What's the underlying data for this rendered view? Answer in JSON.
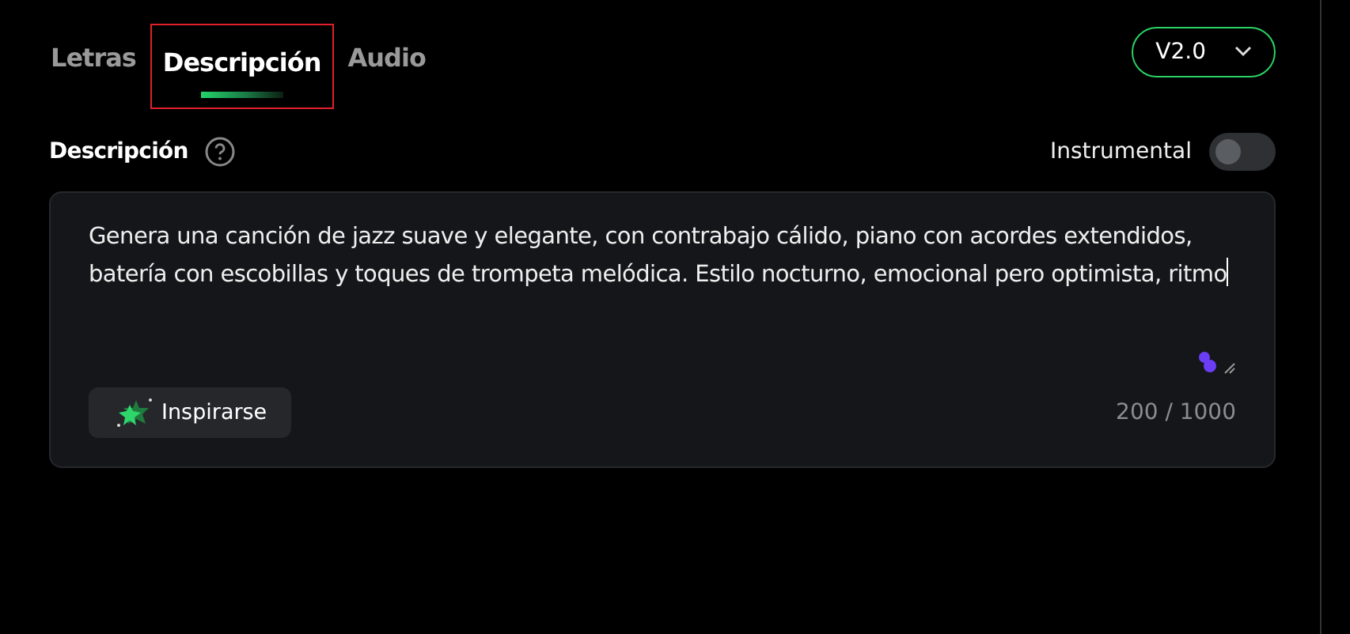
{
  "tabs": [
    {
      "label": "Letras",
      "selected": false
    },
    {
      "label": "Descripción",
      "selected": true
    },
    {
      "label": "Audio",
      "selected": false
    }
  ],
  "version_select": {
    "value": "V2.0"
  },
  "description": {
    "label": "Descripción",
    "instrumental": {
      "label": "Instrumental",
      "on": false
    },
    "value": "Genera una canción de jazz suave y elegante, con contrabajo cálido, piano con acordes extendidos, batería con escobillas y toques de trompeta melódica. Estilo nocturno, emocional pero optimista, ritmo",
    "inspire_button": "Inspirarse",
    "counter": "200 / 1000"
  }
}
